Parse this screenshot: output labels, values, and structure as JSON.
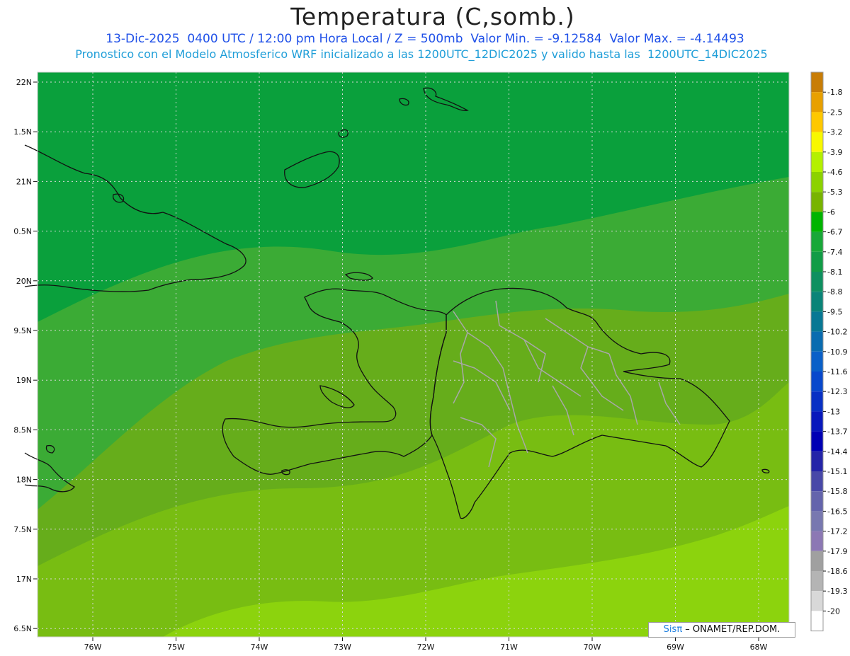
{
  "header": {
    "title": "Temperatura (C,somb.)",
    "line1": "13-Dic-2025  0400 UTC / 12:00 pm Hora Local / Z = 500mb  Valor Min. = -9.12584  Valor Max. = -4.14493",
    "line2": "Pronostico con el Modelo Atmosferico WRF inicializado a las 1200UTC_12DIC2025 y valido hasta las  1200UTC_14DIC2025"
  },
  "map": {
    "lat_ticks": [
      "22N",
      "1.5N",
      "21N",
      "0.5N",
      "20N",
      "9.5N",
      "19N",
      "8.5N",
      "18N",
      "7.5N",
      "17N",
      "6.5N"
    ],
    "lon_ticks": [
      "76W",
      "75W",
      "74W",
      "73W",
      "72W",
      "71W",
      "70W",
      "69W",
      "68W"
    ],
    "regions": [
      {
        "name": "north-sea",
        "color": "#0aa03c"
      },
      {
        "name": "mid-band",
        "color": "#3bab35"
      },
      {
        "name": "hispaniola-interior",
        "color": "#66ad1b"
      },
      {
        "name": "south-band",
        "color": "#78bd12"
      },
      {
        "name": "far-south",
        "color": "#8cd30d"
      }
    ]
  },
  "legend": {
    "labels": [
      "-1.8",
      "-2.5",
      "-3.2",
      "-3.9",
      "-4.6",
      "-5.3",
      "-6",
      "-6.7",
      "-7.4",
      "-8.1",
      "-8.8",
      "-9.5",
      "-10.2",
      "-10.9",
      "-11.6",
      "-12.3",
      "-13",
      "-13.7",
      "-14.4",
      "-15.1",
      "-15.8",
      "-16.5",
      "-17.2",
      "-17.9",
      "-18.6",
      "-19.3",
      "-20"
    ],
    "colors": [
      "#c87d06",
      "#e8a000",
      "#ffc800",
      "#f8f800",
      "#b4f000",
      "#8cd200",
      "#78b400",
      "#00b400",
      "#18a838",
      "#119c46",
      "#0e9060",
      "#0a8478",
      "#087894",
      "#0a6cb0",
      "#0a60c8",
      "#0848cc",
      "#0830c4",
      "#0818bc",
      "#0000b4",
      "#2424a8",
      "#4848a8",
      "#6464ac",
      "#7878b0",
      "#8c78b4",
      "#a0a0a0",
      "#b4b4b4",
      "#d8d8d8",
      "#ffffff"
    ]
  },
  "credit": {
    "brand": "Sis",
    "pi": "π",
    "text": "– ONAMET/REP.DOM."
  }
}
